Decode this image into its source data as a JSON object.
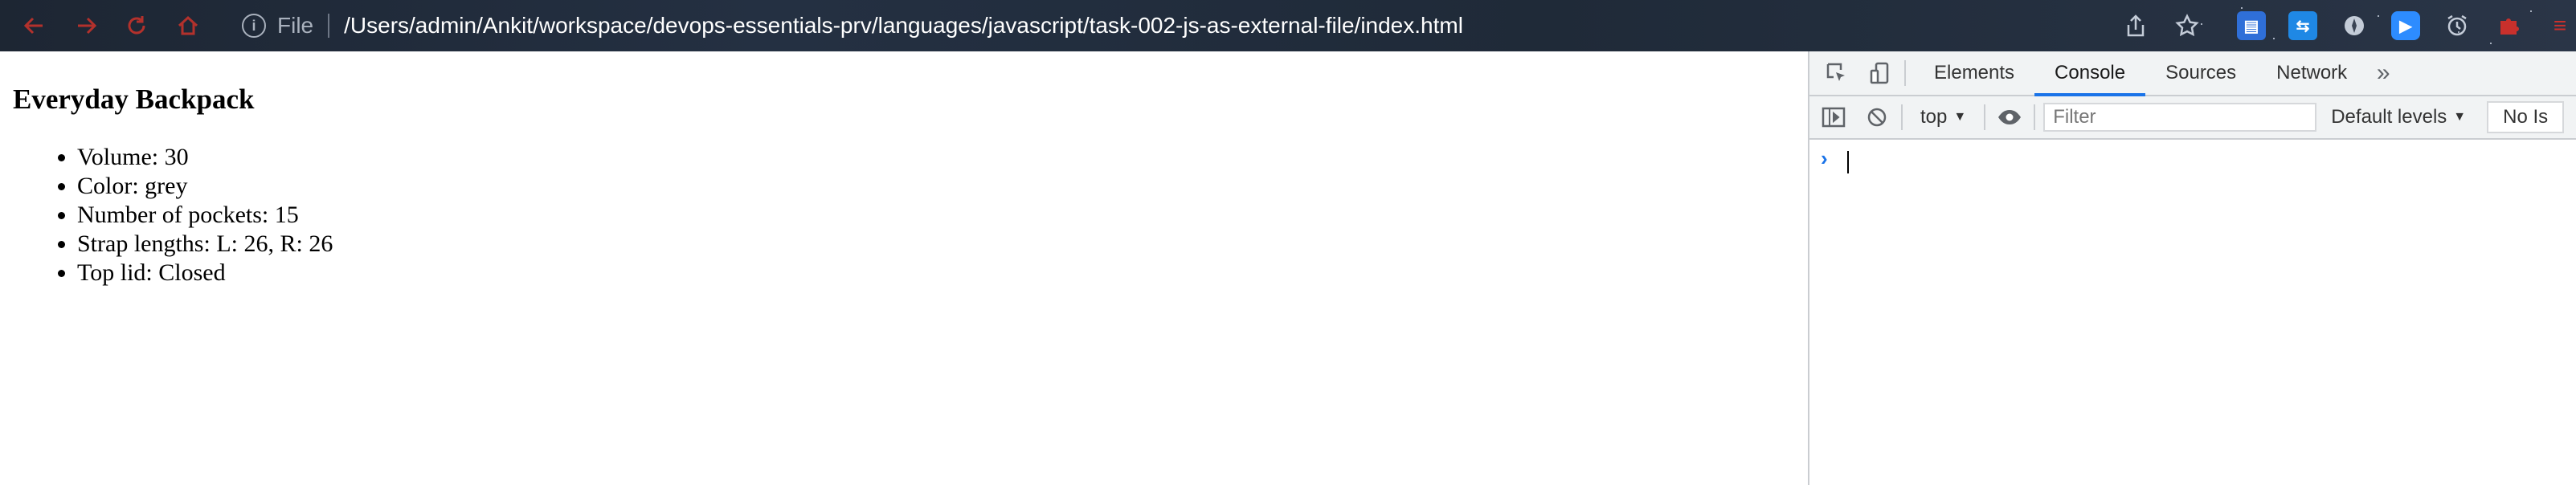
{
  "browser": {
    "nav": {
      "back_icon": "arrow-left",
      "forward_icon": "arrow-right",
      "reload_icon": "reload",
      "home_icon": "home"
    },
    "address_bar": {
      "info_icon": "i",
      "scheme_label": "File",
      "url": "/Users/admin/Ankit/workspace/devops-essentials-prv/languages/javascript/task-002-js-as-external-file/index.html"
    },
    "accent_color": "#b3312c"
  },
  "page": {
    "title": "Everyday Backpack",
    "items": [
      "Volume: 30",
      "Color: grey",
      "Number of pockets: 15",
      "Strap lengths: L: 26, R: 26",
      "Top lid: Closed"
    ]
  },
  "devtools": {
    "tabs": [
      "Elements",
      "Console",
      "Sources",
      "Network"
    ],
    "active_tab": "Console",
    "more_tabs_glyph": "»",
    "context": "top",
    "filter_placeholder": "Filter",
    "levels": "Default levels",
    "issues": "No Is",
    "prompt": "›",
    "active_color": "#1a73e8"
  }
}
